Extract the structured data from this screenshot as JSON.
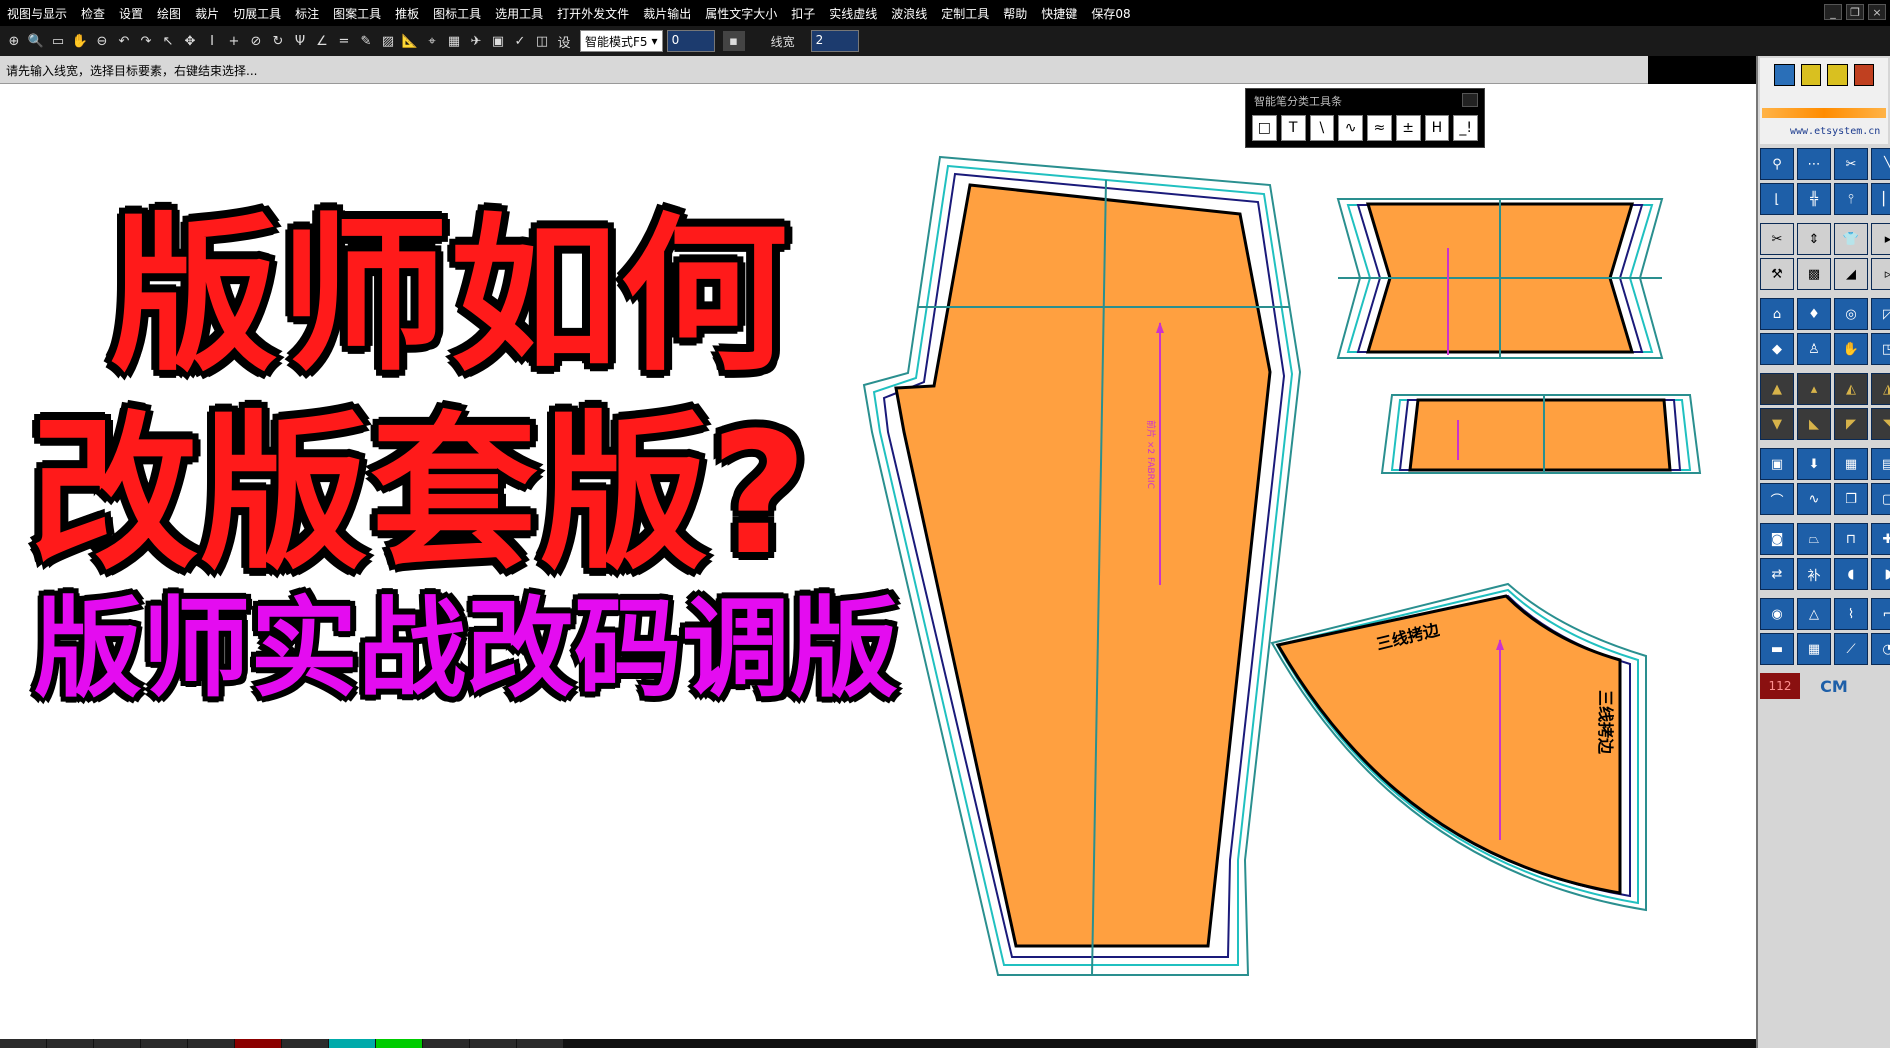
{
  "menubar": {
    "items": [
      "视图与显示",
      "检查",
      "设置",
      "绘图",
      "裁片",
      "切展工具",
      "标注",
      "图案工具",
      "推板",
      "图标工具",
      "选用工具",
      "打开外发文件",
      "裁片输出",
      "属性文字大小",
      "扣子",
      "实线虚线",
      "波浪线",
      "定制工具",
      "帮助",
      "快捷键",
      "保存08"
    ]
  },
  "toolbar": {
    "mode_select": "智能模式F5",
    "mode_value": "0",
    "line_width_label": "线宽",
    "line_width_value": "2",
    "set_label": "设"
  },
  "status": {
    "prompt": "请先输入线宽，选择目标要素，右键结束选择..."
  },
  "overlay": {
    "title_line1": "版师如何",
    "title_line2": "改版套版?",
    "subtitle": "版师实战改码调版"
  },
  "smart_toolbar": {
    "title": "智能笔分类工具条",
    "tools": [
      "□",
      "T",
      "\\",
      "∿",
      "≈",
      "±",
      "H",
      "_!"
    ]
  },
  "right_panel": {
    "url": "www.etsystem.cn",
    "size_number": "112",
    "unit": "CM"
  },
  "pattern_labels": {
    "overlock_1": "三线拷边",
    "overlock_2": "三线拷边"
  },
  "colors": {
    "piece_fill": "#ffa040",
    "seam_teal": "#2a8f8f",
    "seam_navy": "#1a1a7a",
    "seam_cyan": "#20c0c0",
    "grain_line": "#cc33cc",
    "title_red": "#ff1a1a",
    "subtitle_magenta": "#e40cf0"
  }
}
